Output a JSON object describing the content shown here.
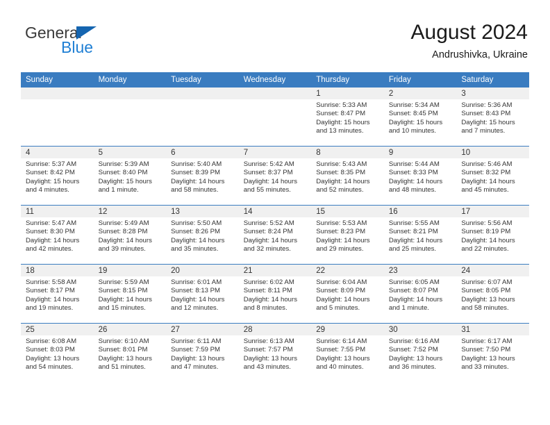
{
  "brand": {
    "line1": "General",
    "line2": "Blue",
    "logo_icon": "triangle-logo-icon",
    "accent_color": "#1f7fd4"
  },
  "header": {
    "title": "August 2024",
    "subtitle": "Andrushivka, Ukraine"
  },
  "theme": {
    "header_bg": "#3a7cc0",
    "header_text": "#ffffff",
    "daynum_band_bg": "#f0f0f0",
    "grid_line": "#3a7cc0",
    "body_text": "#333333"
  },
  "calendar": {
    "weekday_headers": [
      "Sunday",
      "Monday",
      "Tuesday",
      "Wednesday",
      "Thursday",
      "Friday",
      "Saturday"
    ],
    "labels": {
      "sunrise": "Sunrise:",
      "sunset": "Sunset:",
      "daylight": "Daylight:"
    },
    "weeks": [
      [
        {
          "day": "",
          "empty": true
        },
        {
          "day": "",
          "empty": true
        },
        {
          "day": "",
          "empty": true
        },
        {
          "day": "",
          "empty": true
        },
        {
          "day": "1",
          "sunrise": "Sunrise: 5:33 AM",
          "sunset": "Sunset: 8:47 PM",
          "daylight_line1": "Daylight: 15 hours",
          "daylight_line2": "and 13 minutes."
        },
        {
          "day": "2",
          "sunrise": "Sunrise: 5:34 AM",
          "sunset": "Sunset: 8:45 PM",
          "daylight_line1": "Daylight: 15 hours",
          "daylight_line2": "and 10 minutes."
        },
        {
          "day": "3",
          "sunrise": "Sunrise: 5:36 AM",
          "sunset": "Sunset: 8:43 PM",
          "daylight_line1": "Daylight: 15 hours",
          "daylight_line2": "and 7 minutes."
        }
      ],
      [
        {
          "day": "4",
          "sunrise": "Sunrise: 5:37 AM",
          "sunset": "Sunset: 8:42 PM",
          "daylight_line1": "Daylight: 15 hours",
          "daylight_line2": "and 4 minutes."
        },
        {
          "day": "5",
          "sunrise": "Sunrise: 5:39 AM",
          "sunset": "Sunset: 8:40 PM",
          "daylight_line1": "Daylight: 15 hours",
          "daylight_line2": "and 1 minute."
        },
        {
          "day": "6",
          "sunrise": "Sunrise: 5:40 AM",
          "sunset": "Sunset: 8:39 PM",
          "daylight_line1": "Daylight: 14 hours",
          "daylight_line2": "and 58 minutes."
        },
        {
          "day": "7",
          "sunrise": "Sunrise: 5:42 AM",
          "sunset": "Sunset: 8:37 PM",
          "daylight_line1": "Daylight: 14 hours",
          "daylight_line2": "and 55 minutes."
        },
        {
          "day": "8",
          "sunrise": "Sunrise: 5:43 AM",
          "sunset": "Sunset: 8:35 PM",
          "daylight_line1": "Daylight: 14 hours",
          "daylight_line2": "and 52 minutes."
        },
        {
          "day": "9",
          "sunrise": "Sunrise: 5:44 AM",
          "sunset": "Sunset: 8:33 PM",
          "daylight_line1": "Daylight: 14 hours",
          "daylight_line2": "and 48 minutes."
        },
        {
          "day": "10",
          "sunrise": "Sunrise: 5:46 AM",
          "sunset": "Sunset: 8:32 PM",
          "daylight_line1": "Daylight: 14 hours",
          "daylight_line2": "and 45 minutes."
        }
      ],
      [
        {
          "day": "11",
          "sunrise": "Sunrise: 5:47 AM",
          "sunset": "Sunset: 8:30 PM",
          "daylight_line1": "Daylight: 14 hours",
          "daylight_line2": "and 42 minutes."
        },
        {
          "day": "12",
          "sunrise": "Sunrise: 5:49 AM",
          "sunset": "Sunset: 8:28 PM",
          "daylight_line1": "Daylight: 14 hours",
          "daylight_line2": "and 39 minutes."
        },
        {
          "day": "13",
          "sunrise": "Sunrise: 5:50 AM",
          "sunset": "Sunset: 8:26 PM",
          "daylight_line1": "Daylight: 14 hours",
          "daylight_line2": "and 35 minutes."
        },
        {
          "day": "14",
          "sunrise": "Sunrise: 5:52 AM",
          "sunset": "Sunset: 8:24 PM",
          "daylight_line1": "Daylight: 14 hours",
          "daylight_line2": "and 32 minutes."
        },
        {
          "day": "15",
          "sunrise": "Sunrise: 5:53 AM",
          "sunset": "Sunset: 8:23 PM",
          "daylight_line1": "Daylight: 14 hours",
          "daylight_line2": "and 29 minutes."
        },
        {
          "day": "16",
          "sunrise": "Sunrise: 5:55 AM",
          "sunset": "Sunset: 8:21 PM",
          "daylight_line1": "Daylight: 14 hours",
          "daylight_line2": "and 25 minutes."
        },
        {
          "day": "17",
          "sunrise": "Sunrise: 5:56 AM",
          "sunset": "Sunset: 8:19 PM",
          "daylight_line1": "Daylight: 14 hours",
          "daylight_line2": "and 22 minutes."
        }
      ],
      [
        {
          "day": "18",
          "sunrise": "Sunrise: 5:58 AM",
          "sunset": "Sunset: 8:17 PM",
          "daylight_line1": "Daylight: 14 hours",
          "daylight_line2": "and 19 minutes."
        },
        {
          "day": "19",
          "sunrise": "Sunrise: 5:59 AM",
          "sunset": "Sunset: 8:15 PM",
          "daylight_line1": "Daylight: 14 hours",
          "daylight_line2": "and 15 minutes."
        },
        {
          "day": "20",
          "sunrise": "Sunrise: 6:01 AM",
          "sunset": "Sunset: 8:13 PM",
          "daylight_line1": "Daylight: 14 hours",
          "daylight_line2": "and 12 minutes."
        },
        {
          "day": "21",
          "sunrise": "Sunrise: 6:02 AM",
          "sunset": "Sunset: 8:11 PM",
          "daylight_line1": "Daylight: 14 hours",
          "daylight_line2": "and 8 minutes."
        },
        {
          "day": "22",
          "sunrise": "Sunrise: 6:04 AM",
          "sunset": "Sunset: 8:09 PM",
          "daylight_line1": "Daylight: 14 hours",
          "daylight_line2": "and 5 minutes."
        },
        {
          "day": "23",
          "sunrise": "Sunrise: 6:05 AM",
          "sunset": "Sunset: 8:07 PM",
          "daylight_line1": "Daylight: 14 hours",
          "daylight_line2": "and 1 minute."
        },
        {
          "day": "24",
          "sunrise": "Sunrise: 6:07 AM",
          "sunset": "Sunset: 8:05 PM",
          "daylight_line1": "Daylight: 13 hours",
          "daylight_line2": "and 58 minutes."
        }
      ],
      [
        {
          "day": "25",
          "sunrise": "Sunrise: 6:08 AM",
          "sunset": "Sunset: 8:03 PM",
          "daylight_line1": "Daylight: 13 hours",
          "daylight_line2": "and 54 minutes."
        },
        {
          "day": "26",
          "sunrise": "Sunrise: 6:10 AM",
          "sunset": "Sunset: 8:01 PM",
          "daylight_line1": "Daylight: 13 hours",
          "daylight_line2": "and 51 minutes."
        },
        {
          "day": "27",
          "sunrise": "Sunrise: 6:11 AM",
          "sunset": "Sunset: 7:59 PM",
          "daylight_line1": "Daylight: 13 hours",
          "daylight_line2": "and 47 minutes."
        },
        {
          "day": "28",
          "sunrise": "Sunrise: 6:13 AM",
          "sunset": "Sunset: 7:57 PM",
          "daylight_line1": "Daylight: 13 hours",
          "daylight_line2": "and 43 minutes."
        },
        {
          "day": "29",
          "sunrise": "Sunrise: 6:14 AM",
          "sunset": "Sunset: 7:55 PM",
          "daylight_line1": "Daylight: 13 hours",
          "daylight_line2": "and 40 minutes."
        },
        {
          "day": "30",
          "sunrise": "Sunrise: 6:16 AM",
          "sunset": "Sunset: 7:52 PM",
          "daylight_line1": "Daylight: 13 hours",
          "daylight_line2": "and 36 minutes."
        },
        {
          "day": "31",
          "sunrise": "Sunrise: 6:17 AM",
          "sunset": "Sunset: 7:50 PM",
          "daylight_line1": "Daylight: 13 hours",
          "daylight_line2": "and 33 minutes."
        }
      ]
    ]
  }
}
